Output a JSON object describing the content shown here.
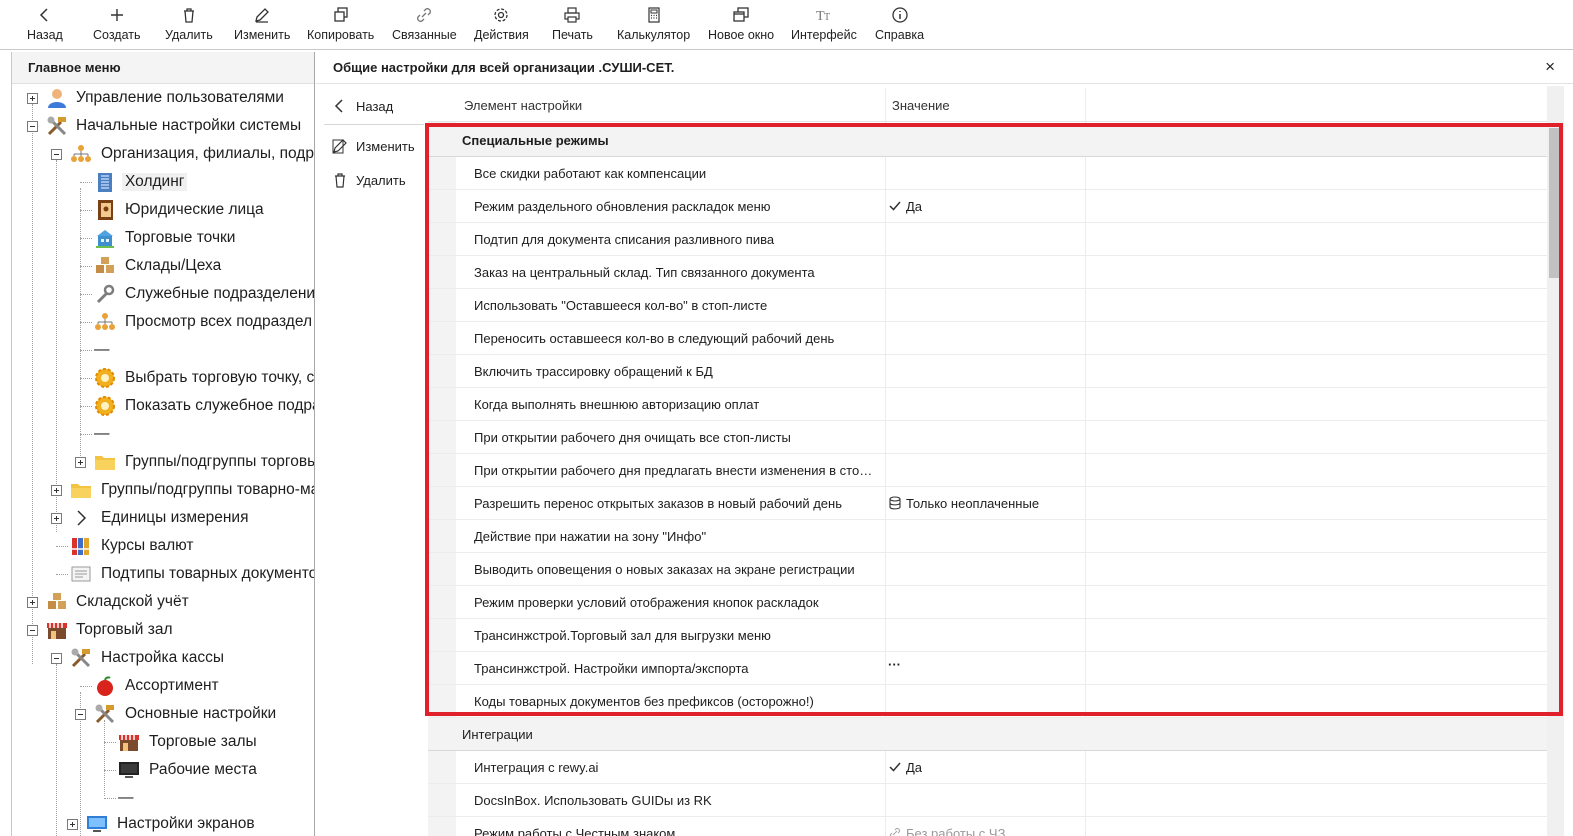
{
  "toolbar": {
    "back": "Назад",
    "create": "Создать",
    "delete": "Удалить",
    "edit": "Изменить",
    "copy": "Копировать",
    "linked": "Связанные",
    "actions": "Действия",
    "print": "Печать",
    "calculator": "Калькулятор",
    "new_window": "Новое окно",
    "interface": "Интерфейс",
    "help": "Справка"
  },
  "left_panel": {
    "title": "Главное меню",
    "items": [
      "Управление пользователями",
      "Начальные настройки системы",
      "Организация, филиалы, подра",
      "Холдинг",
      "Юридические лица",
      "Торговые точки",
      "Склады/Цеха",
      "Служебные подразделени",
      "Просмотр всех подраздел",
      "—",
      "Выбрать торговую точку, с",
      "Показать служебное подра",
      "—",
      "Группы/подгруппы торговы",
      "Группы/подгруппы товарно-ма",
      "Единицы измерения",
      "Курсы валют",
      "Подтипы товарных документо",
      "Складской учёт",
      "Торговый зал",
      "Настройка кассы",
      "Ассортимент",
      "Основные настройки",
      "Торговые залы",
      "Рабочие места",
      "—",
      "Настройки экранов"
    ]
  },
  "right_panel": {
    "title": "Общие настройки для всей организации .СУШИ-СЕТ.",
    "close": "×",
    "actions": {
      "back": "Назад",
      "edit": "Изменить",
      "delete": "Удалить"
    },
    "columns": {
      "element": "Элемент настройки",
      "value": "Значение"
    },
    "group_special": "Специальные режимы",
    "rows_special": [
      {
        "key": "Все скидки работают как компенсации",
        "value": ""
      },
      {
        "key": "Режим раздельного обновления раскладок меню",
        "value": "Да"
      },
      {
        "key": "Подтип для документа списания разливного пива",
        "value": ""
      },
      {
        "key": "Заказ на центральный склад. Тип связанного документа",
        "value": ""
      },
      {
        "key": "Использовать \"Оставшееся кол-во\" в стоп-листе",
        "value": ""
      },
      {
        "key": "Переносить оставшееся кол-во в следующий рабочий день",
        "value": ""
      },
      {
        "key": "Включить трассировку обращений к БД",
        "value": ""
      },
      {
        "key": "Когда выполнять внешнюю авторизацию оплат",
        "value": ""
      },
      {
        "key": "При открытии рабочего дня очищать все стоп-листы",
        "value": ""
      },
      {
        "key": "При открытии рабочего дня предлагать внести изменения в стоп-...",
        "value": ""
      },
      {
        "key": "Разрешить перенос открытых заказов в новый рабочий день",
        "value": "Только неоплаченные"
      },
      {
        "key": "Действие при нажатии на зону \"Инфо\"",
        "value": ""
      },
      {
        "key": "Выводить оповещения о новых заказах на экране регистрации",
        "value": ""
      },
      {
        "key": "Режим проверки условий отображения кнопок раскладок",
        "value": ""
      },
      {
        "key": "Трансинжстрой.Торговый зал для выгрузки меню",
        "value": ""
      },
      {
        "key": "Трансинжстрой. Настройки импорта/экспорта",
        "value": "···"
      },
      {
        "key": "Коды товарных документов без префиксов (осторожно!)",
        "value": ""
      }
    ],
    "group_integrations": "Интеграции",
    "rows_integrations": [
      {
        "key": "Интеграция с rewy.ai",
        "value": "Да"
      },
      {
        "key": "DocsInBox. Использовать GUIDы из RK",
        "value": ""
      },
      {
        "key": "Режим работы с Честным знаком",
        "value": "Без работы с ЧЗ"
      }
    ]
  },
  "colors": {
    "highlight": "#e0202b",
    "accent_border": "#c9c9c9"
  }
}
